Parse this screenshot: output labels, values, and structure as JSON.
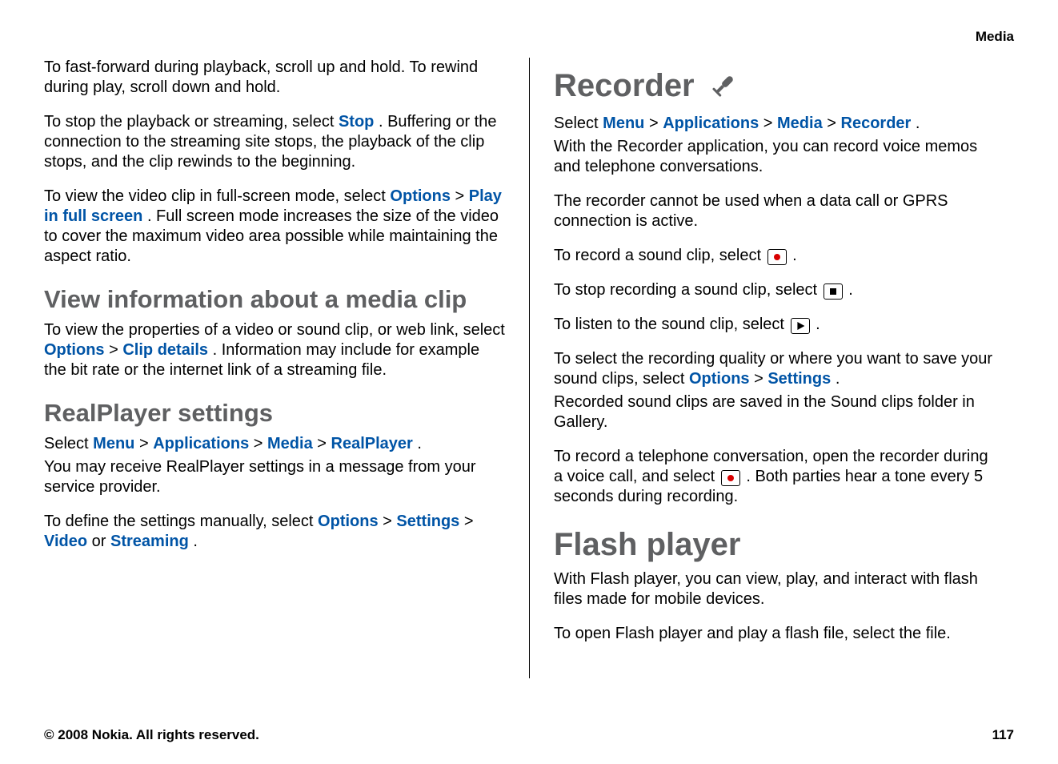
{
  "header": {
    "section": "Media"
  },
  "left": {
    "p1": "To fast-forward during playback, scroll up and hold. To rewind during play, scroll down and hold.",
    "p2": {
      "t1": "To stop the playback or streaming, select ",
      "stop": "Stop",
      "t2": ". Buffering or the connection to the streaming site stops, the playback of the clip stops, and the clip rewinds to the beginning."
    },
    "p3": {
      "t1": "To view the video clip in full-screen mode, select ",
      "options": "Options",
      "t2": " > ",
      "play_full": "Play in full screen",
      "t3": ". Full screen mode increases the size of the video to cover the maximum video area possible while maintaining the aspect ratio."
    },
    "h2a": "View information about a media clip",
    "p4": {
      "t1": "To view the properties of a video or sound clip, or web link, select ",
      "options": "Options",
      "t2": " > ",
      "clip": "Clip details",
      "t3": ". Information may include for example the bit rate or the internet link of a streaming file."
    },
    "h2b": "RealPlayer settings",
    "p5": {
      "t1": "Select ",
      "menu": "Menu",
      "sep1": " > ",
      "apps": "Applications",
      "sep2": " > ",
      "media": "Media",
      "sep3": " > ",
      "real": "RealPlayer",
      "t2": "."
    },
    "p6": "You may receive RealPlayer settings in a message from your service provider.",
    "p7": {
      "t1": "To define the settings manually, select ",
      "options": "Options",
      "sep1": " > ",
      "settings": "Settings",
      "sep2": " > ",
      "video": "Video",
      "t2": " or ",
      "streaming": "Streaming",
      "t3": "."
    }
  },
  "right": {
    "h1": "Recorder",
    "p1": {
      "t1": "Select ",
      "menu": "Menu",
      "sep1": " > ",
      "apps": "Applications",
      "sep2": " > ",
      "media": "Media",
      "sep3": " > ",
      "recorder": "Recorder",
      "t2": "."
    },
    "p2": "With the Recorder application, you can record voice memos and telephone conversations.",
    "p3": "The recorder cannot be used when a data call or GPRS connection is active.",
    "p4_t1": "To record a sound clip, select ",
    "p4_t2": ".",
    "p5_t1": "To stop recording a sound clip, select ",
    "p5_t2": ".",
    "p6_t1": "To listen to the sound clip, select ",
    "p6_t2": ".",
    "p7": {
      "t1": "To select the recording quality or where you want to save your sound clips, select ",
      "options": "Options",
      "sep": " > ",
      "settings": "Settings",
      "t2": "."
    },
    "p8": "Recorded sound clips are saved in the Sound clips folder in Gallery.",
    "p9_t1": "To record a telephone conversation, open the recorder during a voice call, and select ",
    "p9_t2": ". Both parties hear a tone every 5 seconds during recording.",
    "h1b": "Flash player",
    "p10": "With Flash player, you can view, play, and interact with flash files made for mobile devices.",
    "p11": "To open Flash player and play a flash file, select the file."
  },
  "footer": {
    "copyright": "© 2008 Nokia. All rights reserved.",
    "page": "117"
  }
}
